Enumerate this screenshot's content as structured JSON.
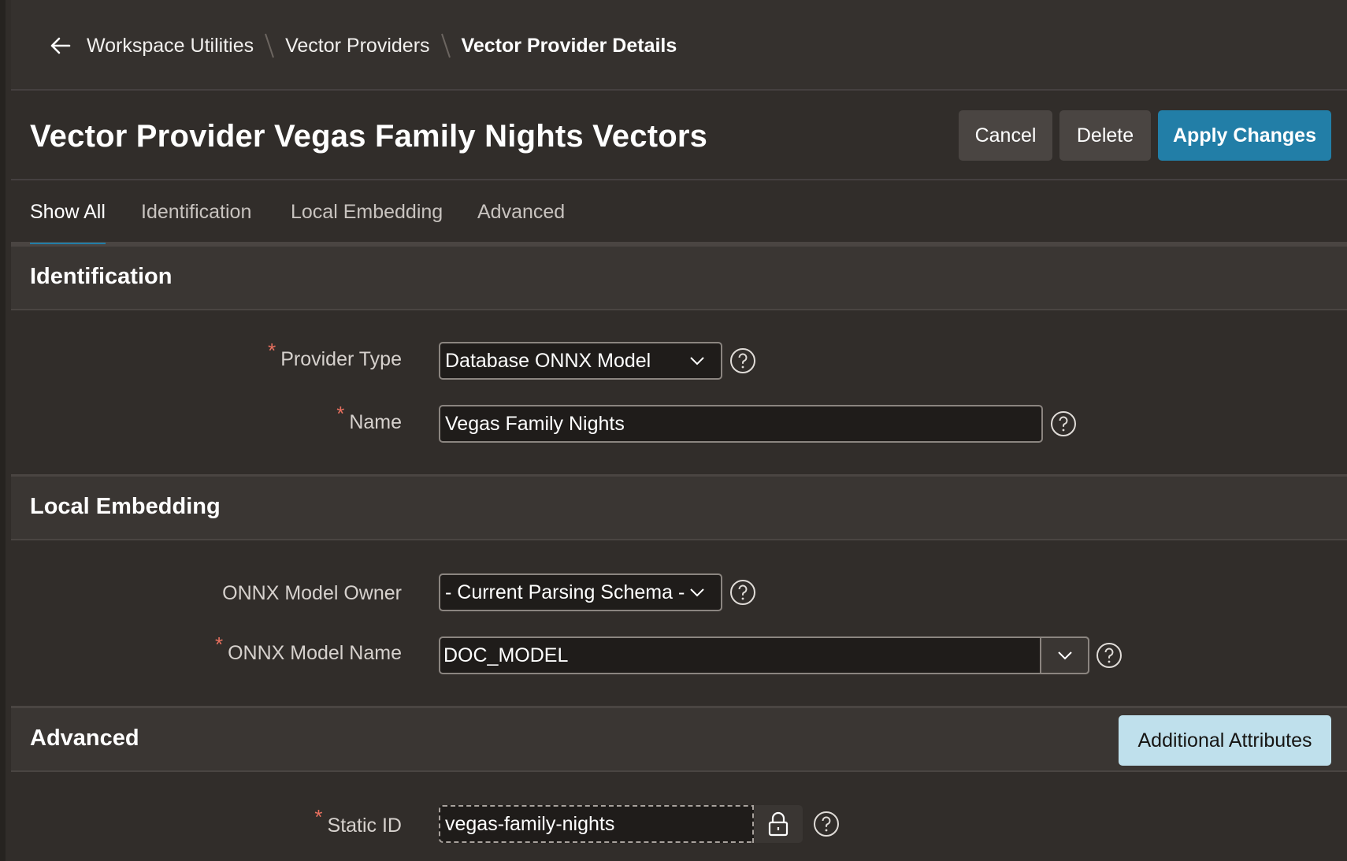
{
  "breadcrumb": {
    "items": [
      "Workspace Utilities",
      "Vector Providers"
    ],
    "current": "Vector Provider Details"
  },
  "header": {
    "title": "Vector Provider Vegas Family Nights Vectors",
    "cancel_label": "Cancel",
    "delete_label": "Delete",
    "apply_label": "Apply Changes"
  },
  "tabs": [
    {
      "label": "Show All",
      "active": true
    },
    {
      "label": "Identification",
      "active": false
    },
    {
      "label": "Local Embedding",
      "active": false
    },
    {
      "label": "Advanced",
      "active": false
    }
  ],
  "sections": {
    "identification": {
      "title": "Identification",
      "provider_type": {
        "label": "Provider Type",
        "required": "*",
        "value": "Database ONNX Model"
      },
      "name": {
        "label": "Name",
        "required": "*",
        "value": "Vegas Family Nights"
      }
    },
    "local_embedding": {
      "title": "Local Embedding",
      "model_owner": {
        "label": "ONNX Model Owner",
        "value": "- Current Parsing Schema -"
      },
      "model_name": {
        "label": "ONNX Model Name",
        "required": "*",
        "value": "DOC_MODEL"
      }
    },
    "advanced": {
      "title": "Advanced",
      "additional_label": "Additional Attributes",
      "static_id": {
        "label": "Static ID",
        "required": "*",
        "value": "vegas-family-nights"
      }
    }
  },
  "colors": {
    "accent": "#227ea7",
    "required": "#e8705f",
    "background": "#312d2a",
    "light_button": "#bfe0ec"
  },
  "icons": {
    "back": "arrow-left-icon",
    "separator": "slash-separator-icon",
    "dropdown": "chevron-down-icon",
    "help": "question-circle-icon",
    "lock": "lock-icon"
  }
}
